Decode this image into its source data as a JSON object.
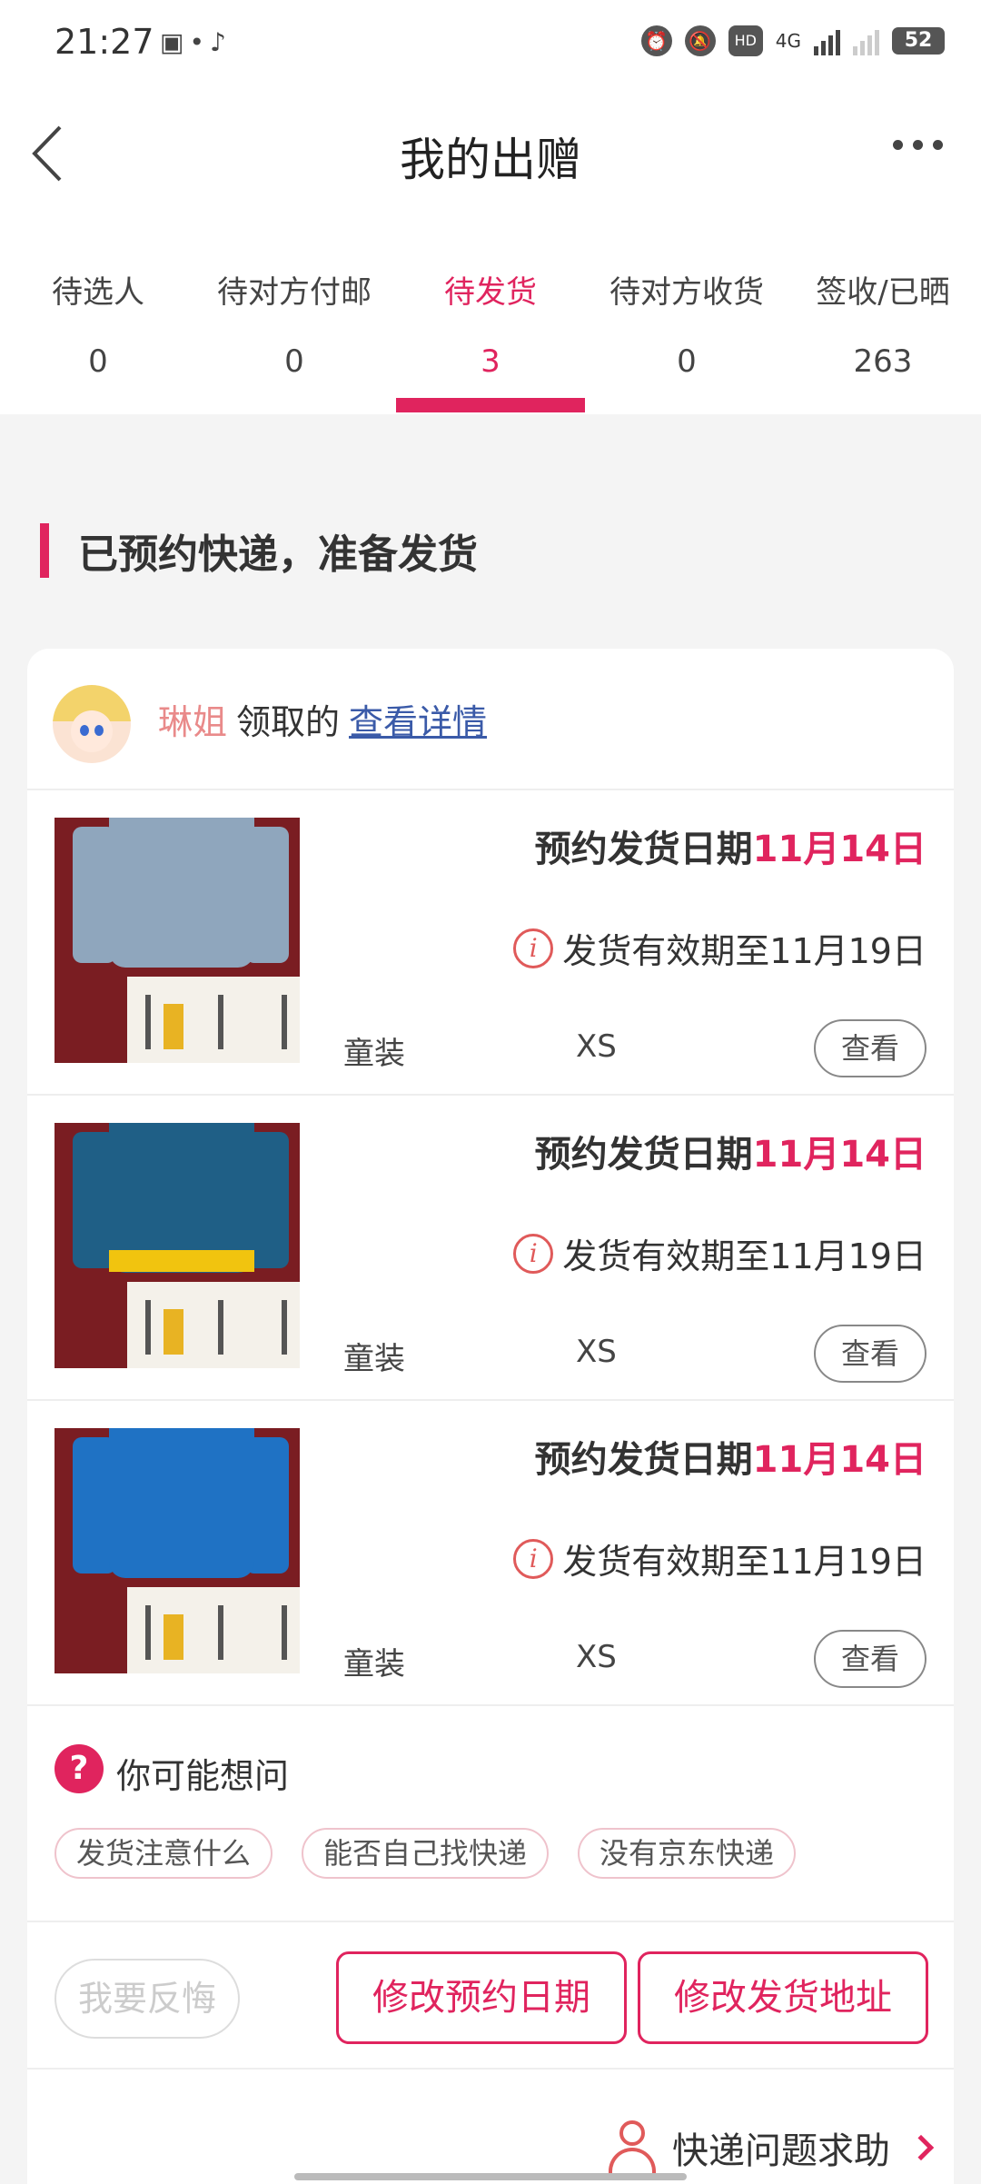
{
  "status_bar": {
    "time": "21:27",
    "battery": "52",
    "network": "4G",
    "hd": "HD"
  },
  "header": {
    "title": "我的出赠"
  },
  "tabs": [
    {
      "label": "待选人",
      "count": "0"
    },
    {
      "label": "待对方付邮",
      "count": "0"
    },
    {
      "label": "待发货",
      "count": "3"
    },
    {
      "label": "待对方收货",
      "count": "0"
    },
    {
      "label": "签收/已晒",
      "count": "263"
    }
  ],
  "active_tab": "待发货",
  "accent_color": "#e0245e",
  "section": {
    "title": "已预约快递，准备发货"
  },
  "card": {
    "receiver_name": "琳姐",
    "received_text": "领取的",
    "detail_link": "查看详情",
    "items": [
      {
        "schedule_label": "预约发货日期",
        "schedule_date": "11月14日",
        "validity": "发货有效期至11月19日",
        "category": "童装",
        "size": "XS",
        "view_label": "查看",
        "garment_color": "#8fa6bd"
      },
      {
        "schedule_label": "预约发货日期",
        "schedule_date": "11月14日",
        "validity": "发货有效期至11月19日",
        "category": "童装",
        "size": "XS",
        "view_label": "查看",
        "garment_color": "#1f5f86"
      },
      {
        "schedule_label": "预约发货日期",
        "schedule_date": "11月14日",
        "validity": "发货有效期至11月19日",
        "category": "童装",
        "size": "XS",
        "view_label": "查看",
        "garment_color": "#1f72c4"
      }
    ],
    "faq": {
      "title": "你可能想问",
      "chips": [
        "发货注意什么",
        "能否自己找快递",
        "没有京东快递"
      ]
    },
    "actions": {
      "regret": "我要反悔",
      "change_date": "修改预约日期",
      "change_address": "修改发货地址"
    },
    "help": {
      "label": "快递问题求助"
    }
  }
}
